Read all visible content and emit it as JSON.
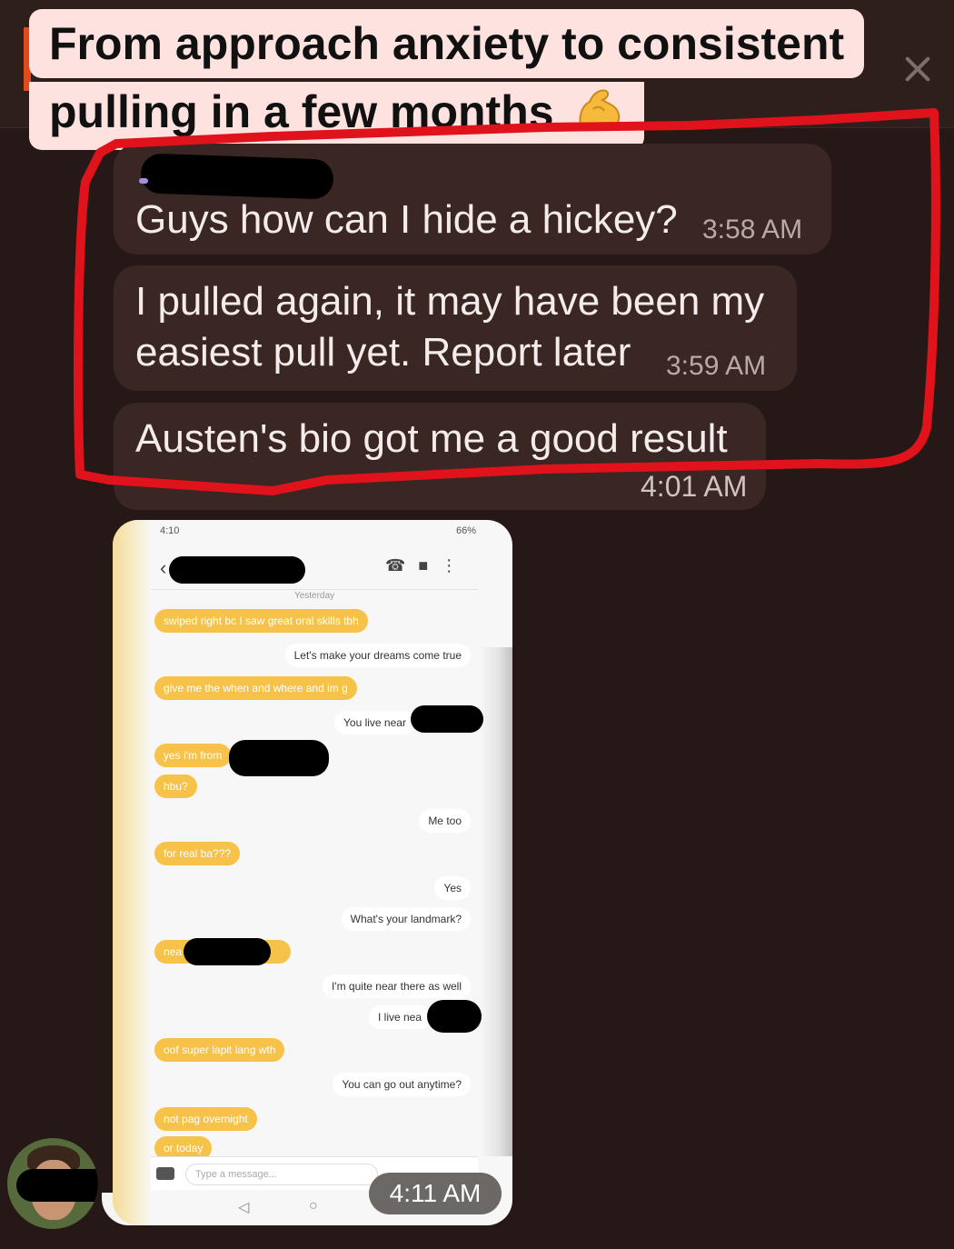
{
  "caption": {
    "line1": "From approach anxiety to consistent",
    "line2": "pulling in a few months",
    "emoji": "flexed-biceps-icon"
  },
  "messages": [
    {
      "text": "Guys how can I hide a hickey?",
      "time": "3:58 AM"
    },
    {
      "text": "I pulled again, it may have been my easiest pull yet. Report later",
      "time": "3:59 AM"
    },
    {
      "text": "Austen's bio got me a good result",
      "time": "4:01 AM"
    }
  ],
  "image_message": {
    "time": "4:11 AM",
    "inner_chat": {
      "status_time": "4:10",
      "battery": "66%",
      "date_label": "Yesterday",
      "messages": [
        {
          "dir": "in",
          "text": "swiped right bc I saw great oral skills tbh"
        },
        {
          "dir": "out",
          "text": "Let's make your dreams come true"
        },
        {
          "dir": "in",
          "text": "give me the when and where and im g"
        },
        {
          "dir": "out",
          "text": "You live near"
        },
        {
          "dir": "in",
          "text": "yes i'm from"
        },
        {
          "dir": "in",
          "text": "hbu?"
        },
        {
          "dir": "out",
          "text": "Me too"
        },
        {
          "dir": "in",
          "text": "for real ba???"
        },
        {
          "dir": "out",
          "text": "Yes"
        },
        {
          "dir": "out",
          "text": "What's your landmark?"
        },
        {
          "dir": "in",
          "text": "nea"
        },
        {
          "dir": "out",
          "text": "I'm quite near there as well"
        },
        {
          "dir": "out",
          "text": "I live nea"
        },
        {
          "dir": "in",
          "text": "oof super lapit lang wth"
        },
        {
          "dir": "out",
          "text": "You can go out anytime?"
        },
        {
          "dir": "in",
          "text": "not pag overnight"
        },
        {
          "dir": "in",
          "text": "or today"
        }
      ],
      "composer_placeholder": "Type a message..."
    }
  },
  "colors": {
    "background": "#261816",
    "bubble": "#3a2622",
    "caption_bg": "#fde2e0",
    "highlight_outline": "#e0121b",
    "incoming_bubble": "#f6c24a"
  }
}
